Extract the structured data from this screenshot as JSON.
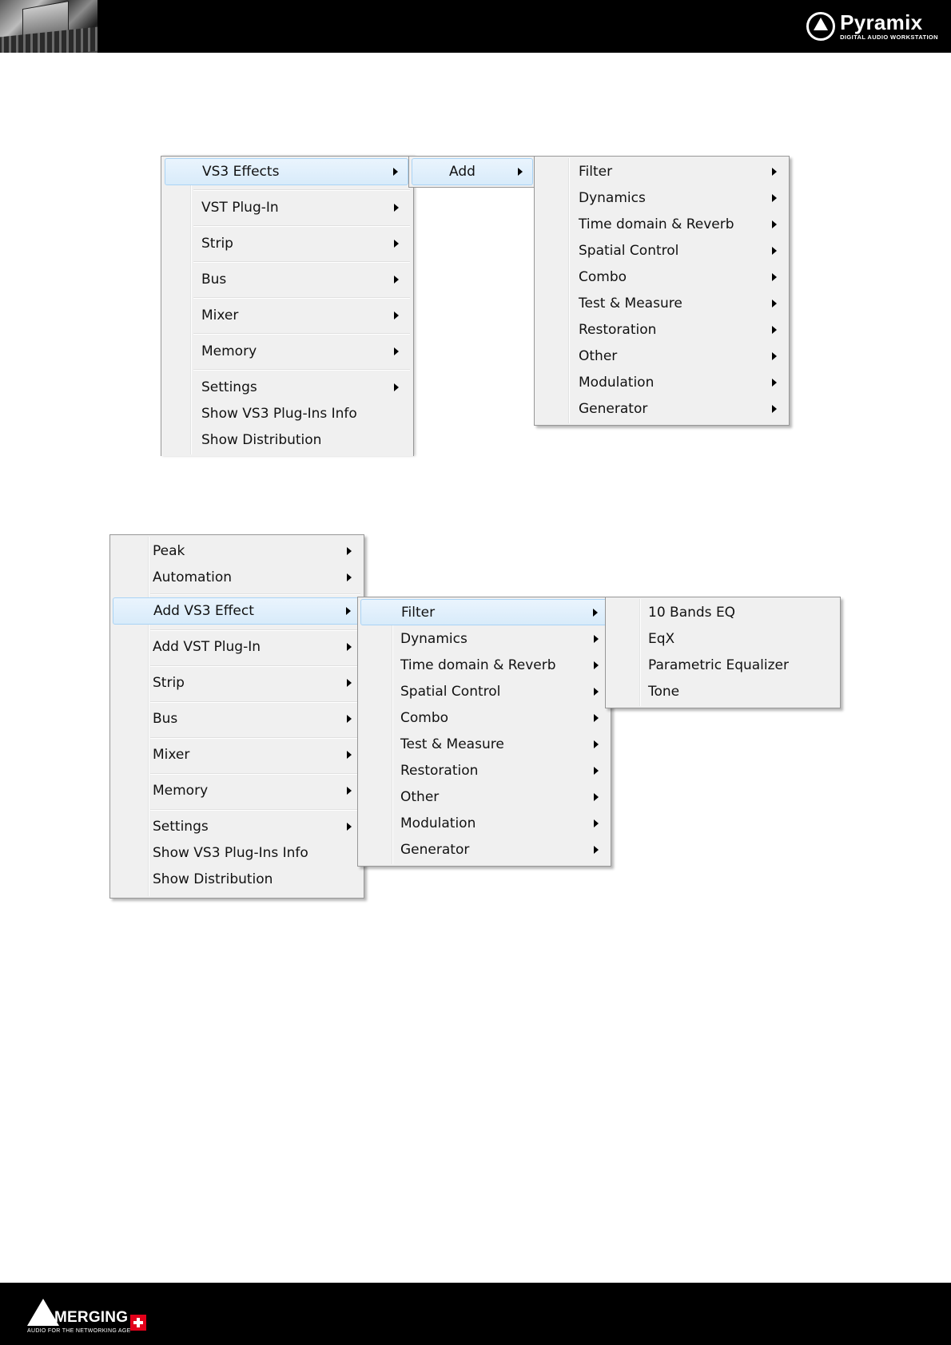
{
  "header": {
    "brand_name": "Pyramix",
    "brand_sub": "DIGITAL AUDIO WORKSTATION"
  },
  "footer": {
    "brand_name": "MERGING",
    "brand_sub": "AUDIO FOR THE NETWORKING AGE"
  },
  "menu1": {
    "main": {
      "items": [
        {
          "label": "VS3 Effects",
          "submenu": true,
          "highlighted": true
        },
        {
          "label": "VST Plug-In",
          "submenu": true
        },
        {
          "label": "Strip",
          "submenu": true
        },
        {
          "label": "Bus",
          "submenu": true
        },
        {
          "label": "Mixer",
          "submenu": true
        },
        {
          "label": "Memory",
          "submenu": true
        },
        {
          "label": "Settings",
          "submenu": true
        },
        {
          "label": "Show VS3 Plug-Ins Info",
          "submenu": false
        },
        {
          "label": "Show Distribution",
          "submenu": false
        }
      ]
    },
    "sub": {
      "items": [
        {
          "label": "Add",
          "submenu": true,
          "highlighted": true
        }
      ]
    },
    "categories": {
      "items": [
        {
          "label": "Filter"
        },
        {
          "label": "Dynamics"
        },
        {
          "label": "Time domain & Reverb"
        },
        {
          "label": "Spatial Control"
        },
        {
          "label": "Combo"
        },
        {
          "label": "Test & Measure"
        },
        {
          "label": "Restoration"
        },
        {
          "label": "Other"
        },
        {
          "label": "Modulation"
        },
        {
          "label": "Generator"
        }
      ]
    }
  },
  "menu2": {
    "main": {
      "items": [
        {
          "label": "Peak",
          "submenu": true
        },
        {
          "label": "Automation",
          "submenu": true
        },
        {
          "label": "Add VS3 Effect",
          "submenu": true,
          "highlighted": true
        },
        {
          "label": "Add VST Plug-In",
          "submenu": true
        },
        {
          "label": "Strip",
          "submenu": true
        },
        {
          "label": "Bus",
          "submenu": true
        },
        {
          "label": "Mixer",
          "submenu": true
        },
        {
          "label": "Memory",
          "submenu": true
        },
        {
          "label": "Settings",
          "submenu": true
        },
        {
          "label": "Show VS3 Plug-Ins Info",
          "submenu": false
        },
        {
          "label": "Show Distribution",
          "submenu": false
        }
      ]
    },
    "categories": {
      "items": [
        {
          "label": "Filter",
          "highlighted": true
        },
        {
          "label": "Dynamics"
        },
        {
          "label": "Time domain & Reverb"
        },
        {
          "label": "Spatial Control"
        },
        {
          "label": "Combo"
        },
        {
          "label": "Test & Measure"
        },
        {
          "label": "Restoration"
        },
        {
          "label": "Other"
        },
        {
          "label": "Modulation"
        },
        {
          "label": "Generator"
        }
      ]
    },
    "filters": {
      "items": [
        {
          "label": "10 Bands EQ"
        },
        {
          "label": "EqX"
        },
        {
          "label": "Parametric Equalizer"
        },
        {
          "label": "Tone"
        }
      ]
    }
  }
}
